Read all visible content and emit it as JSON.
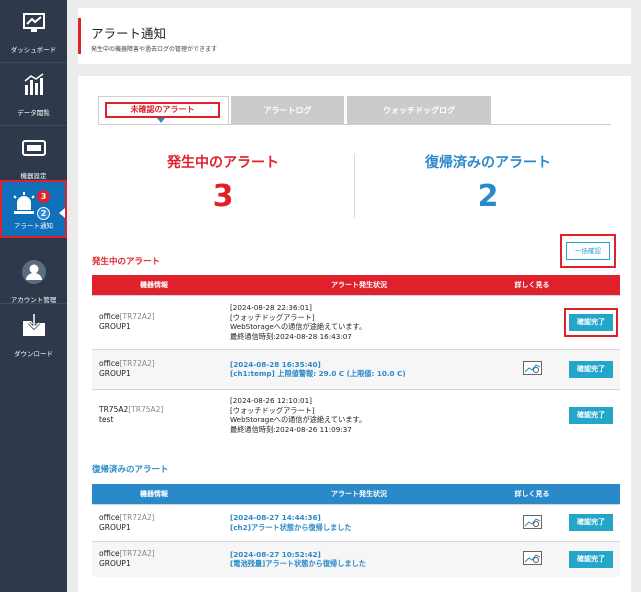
{
  "sidebar": {
    "items": [
      {
        "label": "ダッシュボード",
        "icon": "dashboard-icon"
      },
      {
        "label": "データ閲覧",
        "icon": "bar-chart-icon"
      },
      {
        "label": "機器設定",
        "icon": "device-icon"
      },
      {
        "label": "アラート通知",
        "icon": "alert-siren-icon",
        "badge_red": "3",
        "badge_blue": "2"
      },
      {
        "label": "アカウント管理",
        "icon": "user-icon"
      },
      {
        "label": "ダウンロード",
        "icon": "download-icon"
      }
    ]
  },
  "header": {
    "title": "アラート通知",
    "subtitle": "発生中の機器障害や過去ログの管理ができます"
  },
  "tabs": [
    {
      "label": "未確認のアラート"
    },
    {
      "label": "アラートログ"
    },
    {
      "label": "ウォッチドッグログ"
    }
  ],
  "summary": {
    "active_label": "発生中のアラート",
    "active_count": "3",
    "recovered_label": "復帰済みのアラート",
    "recovered_count": "2"
  },
  "bulk_confirm_label": "一括確認",
  "active_section": {
    "title": "発生中のアラート",
    "headers": [
      "機器情報",
      "アラート発生状況",
      "詳しく見る",
      ""
    ],
    "rows": [
      {
        "name": "office",
        "model": "[TR72A2]",
        "group": "GROUP1",
        "lines": [
          "[2024-08-28 22:36:01]",
          "[ウォッチドッグアラート]",
          "WebStorageへの通信が途絶えています。",
          "最終通信時刻:2024-08-28 16:43:07"
        ],
        "highlight": false,
        "has_detail": false,
        "button": "確認完了"
      },
      {
        "name": "office",
        "model": "[TR72A2]",
        "group": "GROUP1",
        "lines": [
          "[2024-08-28 16:35:40]",
          "[ch1:temp] 上限値警報: 29.0 C (上限値: 10.0 C)"
        ],
        "highlight": true,
        "has_detail": true,
        "button": "確認完了"
      },
      {
        "name": "TR75A2",
        "model": "[TR75A2]",
        "group": "test",
        "lines": [
          "[2024-08-26 12:10:01]",
          "[ウォッチドッグアラート]",
          "WebStorageへの通信が途絶えています。",
          "最終通信時刻:2024-08-26 11:09:37"
        ],
        "highlight": false,
        "has_detail": false,
        "button": "確認完了"
      }
    ]
  },
  "recovered_section": {
    "title": "復帰済みのアラート",
    "headers": [
      "機器情報",
      "アラート発生状況",
      "詳しく見る",
      ""
    ],
    "rows": [
      {
        "name": "office",
        "model": "[TR72A2]",
        "group": "GROUP1",
        "lines": [
          "[2024-08-27 14:44:36]",
          "[ch2]アラート状態から復帰しました"
        ],
        "highlight": true,
        "has_detail": true,
        "button": "確認完了"
      },
      {
        "name": "office",
        "model": "[TR72A2]",
        "group": "GROUP1",
        "lines": [
          "[2024-08-27 10:52:42]",
          "[電池残量]アラート状態から復帰しました"
        ],
        "highlight": true,
        "has_detail": true,
        "button": "確認完了"
      }
    ]
  },
  "colors": {
    "accent_red": "#e0202a",
    "accent_blue": "#2a8ac9",
    "button": "#23a6c9",
    "sidebar": "#2e3a4b"
  }
}
